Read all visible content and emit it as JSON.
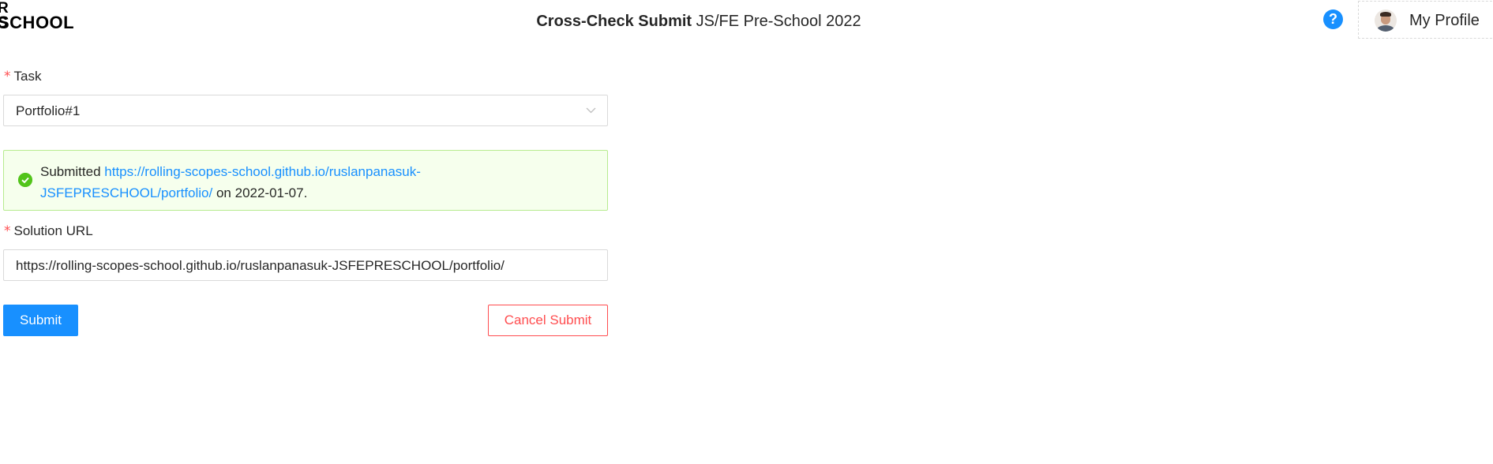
{
  "header": {
    "logo_top": "R S",
    "logo_bottom": "SCHOOL",
    "title_bold": "Cross-Check Submit",
    "title_rest": " JS/FE Pre-School 2022",
    "help_glyph": "?",
    "profile_label": "My Profile"
  },
  "form": {
    "task_required_mark": "*",
    "task_label": "Task",
    "task_value": "Portfolio#1",
    "alert": {
      "prefix": "Submitted ",
      "link": "https://rolling-scopes-school.github.io/ruslanpanasuk-JSFEPRESCHOOL/portfolio/",
      "middle": " on ",
      "date": "2022-01-07",
      "suffix": "."
    },
    "url_required_mark": "*",
    "url_label": "Solution URL",
    "url_value": "https://rolling-scopes-school.github.io/ruslanpanasuk-JSFEPRESCHOOL/portfolio/",
    "submit_label": "Submit",
    "cancel_label": "Cancel Submit"
  },
  "colors": {
    "primary": "#1890ff",
    "danger": "#ff4d4f",
    "success": "#52c41a",
    "success_bg": "#f6ffed",
    "success_border": "#b7eb8f"
  },
  "icons": {
    "help": "question-circle-icon",
    "avatar": "user-avatar",
    "select_arrow": "chevron-down-icon",
    "alert": "check-circle-icon"
  }
}
